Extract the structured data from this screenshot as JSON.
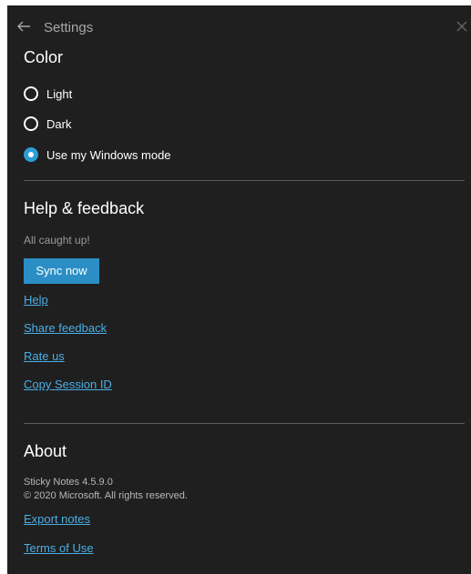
{
  "header": {
    "title": "Settings"
  },
  "color_section": {
    "title": "Color",
    "options": [
      {
        "label": "Light",
        "checked": false
      },
      {
        "label": "Dark",
        "checked": false
      },
      {
        "label": "Use my Windows mode",
        "checked": true
      }
    ]
  },
  "help_section": {
    "title": "Help & feedback",
    "status": "All caught up!",
    "sync_label": "Sync now",
    "links": [
      "Help",
      "Share feedback",
      "Rate us",
      "Copy Session ID"
    ]
  },
  "about_section": {
    "title": "About",
    "version": "Sticky Notes 4.5.9.0",
    "copyright": "© 2020 Microsoft. All rights reserved.",
    "links": [
      "Export notes",
      "Terms of Use"
    ]
  },
  "colors": {
    "accent": "#2b9fd6",
    "link": "#4aaee6",
    "background": "#1f1f1f"
  }
}
